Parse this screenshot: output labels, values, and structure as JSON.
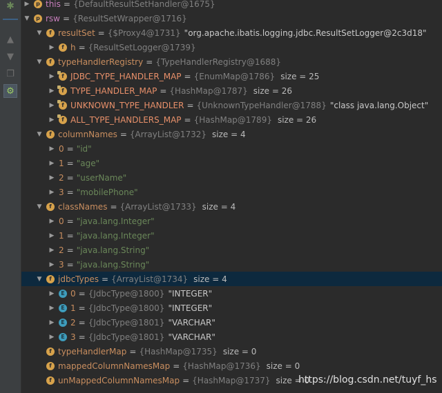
{
  "watermark": "https://blog.csdn.net/tuyf_hs",
  "colors": {
    "background": "#2b2b2b",
    "selection": "#0d293e",
    "field_icon": "#d7a24b",
    "enum_icon": "#3e9dbd"
  },
  "rows": [
    {
      "indent": 0,
      "arrow": "right",
      "icon": "p",
      "iconLabel": "p",
      "name": "this",
      "nameColor": "purple",
      "type": "{DefaultResultSetHandler@1675}",
      "value": "",
      "size": ""
    },
    {
      "indent": 0,
      "arrow": "down",
      "icon": "p",
      "iconLabel": "p",
      "name": "rsw",
      "nameColor": "purple",
      "type": "{ResultSetWrapper@1716}",
      "value": "",
      "size": ""
    },
    {
      "indent": 1,
      "arrow": "down",
      "icon": "f",
      "iconLabel": "f",
      "name": "resultSet",
      "nameColor": "orange",
      "type": "{$Proxy4@1731}",
      "value": "\"org.apache.ibatis.logging.jdbc.ResultSetLogger@2c3d18\"",
      "size": ""
    },
    {
      "indent": 2,
      "arrow": "right",
      "icon": "f",
      "iconLabel": "f",
      "name": "h",
      "nameColor": "orange",
      "type": "{ResultSetLogger@1739}",
      "value": "",
      "size": ""
    },
    {
      "indent": 1,
      "arrow": "down",
      "icon": "f",
      "iconLabel": "f",
      "name": "typeHandlerRegistry",
      "nameColor": "orange",
      "type": "{TypeHandlerRegistry@1688}",
      "value": "",
      "size": ""
    },
    {
      "indent": 2,
      "arrow": "right",
      "icon": "f",
      "iconLabel": "f",
      "name": "JDBC_TYPE_HANDLER_MAP",
      "nameColor": "red",
      "type": "{EnumMap@1786}",
      "value": "",
      "size": "size = 25"
    },
    {
      "indent": 2,
      "arrow": "right",
      "icon": "f",
      "iconLabel": "f",
      "name": "TYPE_HANDLER_MAP",
      "nameColor": "red",
      "type": "{HashMap@1787}",
      "value": "",
      "size": "size = 26"
    },
    {
      "indent": 2,
      "arrow": "right",
      "icon": "f",
      "iconLabel": "f",
      "name": "UNKNOWN_TYPE_HANDLER",
      "nameColor": "red",
      "type": "{UnknownTypeHandler@1788}",
      "value": "\"class java.lang.Object\"",
      "size": ""
    },
    {
      "indent": 2,
      "arrow": "right",
      "icon": "f",
      "iconLabel": "f",
      "name": "ALL_TYPE_HANDLERS_MAP",
      "nameColor": "red",
      "type": "{HashMap@1789}",
      "value": "",
      "size": "size = 26"
    },
    {
      "indent": 1,
      "arrow": "down",
      "icon": "f",
      "iconLabel": "f",
      "name": "columnNames",
      "nameColor": "orange",
      "type": "{ArrayList@1732}",
      "value": "",
      "size": "size = 4"
    },
    {
      "indent": 2,
      "arrow": "right",
      "icon": "",
      "iconLabel": "",
      "name": "0",
      "nameColor": "orange",
      "type": "",
      "value": "\"id\"",
      "size": ""
    },
    {
      "indent": 2,
      "arrow": "right",
      "icon": "",
      "iconLabel": "",
      "name": "1",
      "nameColor": "orange",
      "type": "",
      "value": "\"age\"",
      "size": ""
    },
    {
      "indent": 2,
      "arrow": "right",
      "icon": "",
      "iconLabel": "",
      "name": "2",
      "nameColor": "orange",
      "type": "",
      "value": "\"userName\"",
      "size": ""
    },
    {
      "indent": 2,
      "arrow": "right",
      "icon": "",
      "iconLabel": "",
      "name": "3",
      "nameColor": "orange",
      "type": "",
      "value": "\"mobilePhone\"",
      "size": ""
    },
    {
      "indent": 1,
      "arrow": "down",
      "icon": "f",
      "iconLabel": "f",
      "name": "classNames",
      "nameColor": "orange",
      "type": "{ArrayList@1733}",
      "value": "",
      "size": "size = 4"
    },
    {
      "indent": 2,
      "arrow": "right",
      "icon": "",
      "iconLabel": "",
      "name": "0",
      "nameColor": "orange",
      "type": "",
      "value": "\"java.lang.Integer\"",
      "size": ""
    },
    {
      "indent": 2,
      "arrow": "right",
      "icon": "",
      "iconLabel": "",
      "name": "1",
      "nameColor": "orange",
      "type": "",
      "value": "\"java.lang.Integer\"",
      "size": ""
    },
    {
      "indent": 2,
      "arrow": "right",
      "icon": "",
      "iconLabel": "",
      "name": "2",
      "nameColor": "orange",
      "type": "",
      "value": "\"java.lang.String\"",
      "size": ""
    },
    {
      "indent": 2,
      "arrow": "right",
      "icon": "",
      "iconLabel": "",
      "name": "3",
      "nameColor": "orange",
      "type": "",
      "value": "\"java.lang.String\"",
      "size": ""
    },
    {
      "indent": 1,
      "arrow": "down",
      "icon": "f",
      "iconLabel": "f",
      "name": "jdbcTypes",
      "nameColor": "orange",
      "type": "{ArrayList@1734}",
      "value": "",
      "size": "size = 4",
      "selected": true
    },
    {
      "indent": 2,
      "arrow": "right",
      "icon": "e",
      "iconLabel": "E",
      "name": "0",
      "nameColor": "orange",
      "type": "{JdbcType@1800}",
      "value": "\"INTEGER\"",
      "size": ""
    },
    {
      "indent": 2,
      "arrow": "right",
      "icon": "e",
      "iconLabel": "E",
      "name": "1",
      "nameColor": "orange",
      "type": "{JdbcType@1800}",
      "value": "\"INTEGER\"",
      "size": ""
    },
    {
      "indent": 2,
      "arrow": "right",
      "icon": "e",
      "iconLabel": "E",
      "name": "2",
      "nameColor": "orange",
      "type": "{JdbcType@1801}",
      "value": "\"VARCHAR\"",
      "size": ""
    },
    {
      "indent": 2,
      "arrow": "right",
      "icon": "e",
      "iconLabel": "E",
      "name": "3",
      "nameColor": "orange",
      "type": "{JdbcType@1801}",
      "value": "\"VARCHAR\"",
      "size": ""
    },
    {
      "indent": 1,
      "arrow": "none",
      "icon": "f",
      "iconLabel": "f",
      "name": "typeHandlerMap",
      "nameColor": "orange",
      "type": "{HashMap@1735}",
      "value": "",
      "size": "size = 0"
    },
    {
      "indent": 1,
      "arrow": "none",
      "icon": "f",
      "iconLabel": "f",
      "name": "mappedColumnNamesMap",
      "nameColor": "orange",
      "type": "{HashMap@1736}",
      "value": "",
      "size": "size = 0"
    },
    {
      "indent": 1,
      "arrow": "none",
      "icon": "f",
      "iconLabel": "f",
      "name": "unMappedColumnNamesMap",
      "nameColor": "orange",
      "type": "{HashMap@1737}",
      "value": "",
      "size": "size = 0"
    }
  ]
}
